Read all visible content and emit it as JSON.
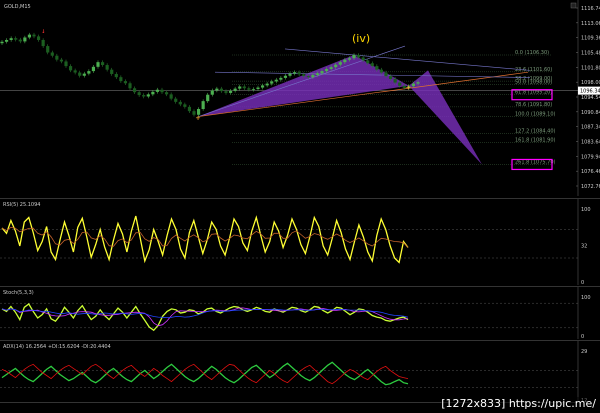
{
  "window": {
    "title": "GOLD,M15"
  },
  "watermark": "[1272x833] https://upic.me/",
  "annotations": {
    "wave_label": "(iv)"
  },
  "colors": {
    "bull": "#4caf50",
    "bear": "#ff3333",
    "wave": "#ffd700",
    "harmonic": "#7b2fbe",
    "rsi": "#ffff33",
    "adx_up": "#2ecc40",
    "adx_dn": "#e01010",
    "magenta_box": "#ff00ff",
    "blue_line": "#2244ff"
  },
  "chart_data": [
    {
      "type": "line",
      "pane": "price",
      "title": "GOLD,M15",
      "ylim": [
        1068,
        1120
      ],
      "y_ticks": [
        "1116.74",
        "1113.06",
        "1109.36",
        "1105.48",
        "1101.80",
        "1098.00",
        "1094.54",
        "1090.84",
        "1087.34",
        "1083.64",
        "1079.94",
        "1076.46",
        "1072.76"
      ],
      "current_price": "1096.34",
      "fib_levels": [
        {
          "label": "0.0",
          "value": 1106.3
        },
        {
          "label": "23.6",
          "value": 1101.6
        },
        {
          "label": "38.2",
          "value": 1099.0
        },
        {
          "label": "50.0",
          "value": 1098.0
        },
        {
          "label": "61.8",
          "value": 1095.2
        },
        {
          "label": "78.6",
          "value": 1091.8
        },
        {
          "label": "100.0",
          "value": 1089.1
        },
        {
          "label": "127.2",
          "value": 1084.4
        },
        {
          "label": "161.8",
          "value": 1081.9
        },
        {
          "label": "261.8",
          "value": 1075.7
        }
      ],
      "highlighted_boxes": [
        {
          "label": "61.8",
          "value": 1095.2
        },
        {
          "label": "261.8",
          "value": 1075.7
        }
      ],
      "close_series": [
        1110,
        1110.5,
        1111,
        1110.6,
        1110.1,
        1111.2,
        1112,
        1111.5,
        1110.5,
        1108.8,
        1107,
        1106.1,
        1105,
        1104.5,
        1103.2,
        1102,
        1101.4,
        1100.5,
        1101.1,
        1101.8,
        1103,
        1104.3,
        1103.5,
        1102.2,
        1101,
        1100.1,
        1099,
        1098.4,
        1097,
        1095.9,
        1095.1,
        1094.7,
        1095.3,
        1096,
        1096.6,
        1095.9,
        1095.3,
        1094.1,
        1093.2,
        1092.5,
        1091.8,
        1090.6,
        1089.6,
        1091.2,
        1093.4,
        1095.2,
        1096.4,
        1096.9,
        1096.2,
        1095.7,
        1096.3,
        1096.9,
        1097.5,
        1097,
        1096.6,
        1096.8,
        1097.2,
        1097.8,
        1098.3,
        1098.9,
        1099.4,
        1099.9,
        1100.5,
        1101.1,
        1101.5,
        1100.9,
        1100.4,
        1100.1,
        1100.7,
        1101.2,
        1101.8,
        1102.4,
        1102.9,
        1103.6,
        1104.3,
        1105,
        1105.4,
        1106.3,
        1105.6,
        1104.8,
        1104,
        1103.2,
        1102.2,
        1101.4,
        1100.4,
        1099.6,
        1098.6,
        1097.7,
        1097.1,
        1097.6,
        1098.3,
        1098.7
      ]
    },
    {
      "type": "line",
      "pane": "rsi",
      "title": "RSI(5) 25.1094",
      "ylim": [
        0,
        100
      ],
      "y_ticks": [
        "100",
        "32",
        "0"
      ],
      "values": [
        72,
        65,
        82,
        68,
        48,
        80,
        86,
        66,
        42,
        54,
        74,
        40,
        30,
        56,
        80,
        62,
        40,
        73,
        85,
        60,
        33,
        50,
        70,
        47,
        30,
        56,
        78,
        64,
        40,
        68,
        88,
        58,
        28,
        43,
        70,
        54,
        36,
        62,
        84,
        70,
        44,
        32,
        66,
        82,
        60,
        38,
        56,
        80,
        70,
        48,
        36,
        58,
        84,
        74,
        52,
        42,
        68,
        86,
        62,
        40,
        54,
        80,
        68,
        46,
        62,
        84,
        70,
        50,
        38,
        60,
        86,
        74,
        48,
        36,
        58,
        82,
        66,
        44,
        30,
        54,
        76,
        60,
        40,
        28,
        62,
        84,
        70,
        48,
        32,
        26,
        54,
        46
      ]
    },
    {
      "type": "line",
      "pane": "stoch",
      "title": "Stoch(5,3,3)",
      "ylim": [
        0,
        100
      ],
      "y_ticks": [
        "100",
        "0"
      ],
      "values": [
        66,
        60,
        72,
        58,
        40,
        70,
        78,
        60,
        44,
        52,
        66,
        42,
        36,
        50,
        70,
        58,
        44,
        62,
        74,
        56,
        40,
        48,
        64,
        50,
        40,
        54,
        68,
        58,
        44,
        58,
        72,
        54,
        38,
        22,
        14,
        26,
        48,
        60,
        66,
        64,
        56,
        58,
        64,
        62,
        54,
        58,
        66,
        68,
        60,
        56,
        62,
        68,
        72,
        70,
        64,
        60,
        64,
        70,
        66,
        60,
        58,
        66,
        62,
        58,
        64,
        70,
        68,
        62,
        58,
        64,
        72,
        70,
        62,
        56,
        62,
        70,
        68,
        60,
        52,
        58,
        66,
        64,
        58,
        50,
        46,
        44,
        38,
        36,
        40,
        44,
        46,
        40
      ]
    },
    {
      "type": "line",
      "pane": "adx",
      "title": "ADX(14) 16.2564 +DI:15.6204 -DI:20.4404",
      "ylim": [
        0,
        50
      ],
      "y_ticks": [
        "29",
        "12"
      ],
      "series": [
        {
          "name": "+DI",
          "values": [
            22,
            25,
            28,
            31,
            27,
            23,
            20,
            18,
            22,
            26,
            30,
            33,
            29,
            25,
            22,
            19,
            21,
            24,
            27,
            23,
            19,
            17,
            20,
            24,
            28,
            31,
            27,
            23,
            20,
            18,
            22,
            26,
            29,
            25,
            21,
            24,
            28,
            32,
            35,
            31,
            27,
            23,
            20,
            18,
            21,
            25,
            29,
            33,
            30,
            26,
            22,
            19,
            17,
            20,
            24,
            28,
            32,
            34,
            30,
            26,
            22,
            25,
            29,
            33,
            36,
            32,
            28,
            24,
            21,
            19,
            22,
            26,
            30,
            34,
            37,
            33,
            29,
            25,
            22,
            20,
            23,
            27,
            30,
            26,
            22,
            18,
            15,
            16,
            18,
            20,
            17,
            16
          ]
        },
        {
          "name": "-DI",
          "values": [
            30,
            28,
            25,
            22,
            26,
            30,
            33,
            35,
            31,
            27,
            24,
            21,
            25,
            29,
            32,
            34,
            31,
            28,
            25,
            29,
            33,
            35,
            32,
            28,
            24,
            21,
            25,
            29,
            32,
            34,
            30,
            26,
            23,
            27,
            31,
            28,
            24,
            21,
            18,
            22,
            26,
            30,
            33,
            35,
            31,
            27,
            23,
            20,
            24,
            28,
            32,
            35,
            34,
            30,
            26,
            22,
            19,
            17,
            21,
            25,
            29,
            26,
            22,
            19,
            17,
            21,
            25,
            29,
            32,
            34,
            30,
            26,
            22,
            18,
            16,
            19,
            23,
            27,
            30,
            28,
            25,
            22,
            20,
            24,
            28,
            31,
            33,
            29,
            26,
            23,
            22,
            21
          ]
        }
      ]
    }
  ]
}
